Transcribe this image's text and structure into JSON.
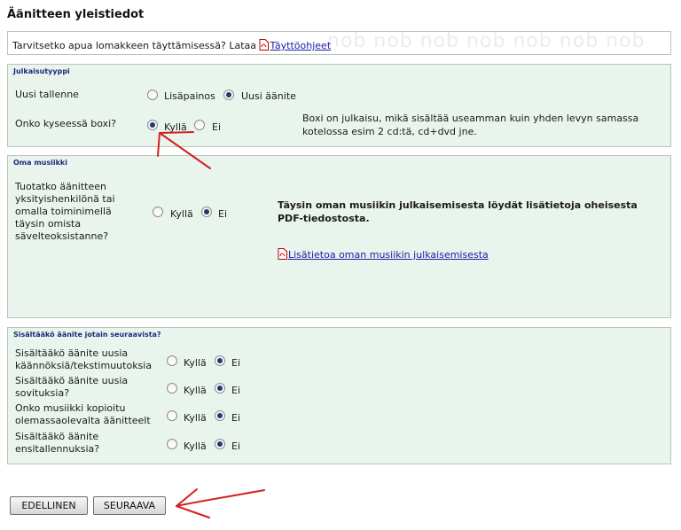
{
  "page": {
    "title": "Äänitteen yleistiedot"
  },
  "help": {
    "text": "Tarvitsetko apua lomakkeen täyttämisessä? Lataa",
    "link": "Täyttöohjeet",
    "watermark": "nob nob nob nob nob nob nob"
  },
  "julkaisutyyppi": {
    "legend": "Julkaisutyyppi",
    "uusi_tallenne": {
      "label": "Uusi tallenne",
      "option_lisapainos": "Lisäpainos",
      "option_uusi_aanite": "Uusi äänite",
      "selected": "Uusi äänite"
    },
    "boxi": {
      "label": "Onko kyseessä boxi?",
      "option_yes": "Kyllä",
      "option_no": "Ei",
      "selected": "Kyllä",
      "info_line1": "Boxi on julkaisu, mikä sisältää useamman kuin yhden levyn samassa",
      "info_line2": "kotelossa esim 2 cd:tä, cd+dvd jne."
    }
  },
  "oma_musiikki": {
    "legend": "Oma musiikki",
    "question_line1": "Tuotatko äänitteen",
    "question_line2": "yksityishenkilönä tai",
    "question_line3": "omalla toiminimellä",
    "question_line4": "täysin omista",
    "question_line5": "sävelteoksistanne?",
    "option_yes": "Kyllä",
    "option_no": "Ei",
    "selected": "Ei",
    "info_line1": "Täysin oman musiikin julkaisemisesta löydät lisätietoja oheisesta",
    "info_line2": "PDF-tiedostosta.",
    "link": "Lisätietoa oman musiikin julkaisemisesta"
  },
  "sisaltaa": {
    "legend": "Sisältääkö äänite jotain seuraavista?",
    "rows": [
      {
        "line1": "Sisältääkö äänite uusia",
        "line2": "käännöksiä/tekstimuutoksia",
        "option_yes": "Kyllä",
        "option_no": "Ei",
        "selected": "Ei"
      },
      {
        "line1": "Sisältääkö äänite uusia",
        "line2": "sovituksia?",
        "option_yes": "Kyllä",
        "option_no": "Ei",
        "selected": "Ei"
      },
      {
        "line1": "Onko musiikki kopioitu",
        "line2": "olemassaolevalta äänitteelt",
        "option_yes": "Kyllä",
        "option_no": "Ei",
        "selected": "Ei"
      },
      {
        "line1": "Sisältääkö äänite",
        "line2": "ensitallennuksia?",
        "option_yes": "Kyllä",
        "option_no": "Ei",
        "selected": "Ei"
      }
    ]
  },
  "buttons": {
    "previous": "EDELLINEN",
    "next": "SEURAAVA"
  },
  "colors": {
    "panel_bg": "#e9f5ec",
    "legend": "#1a2a7a",
    "link": "#1a1aa6",
    "annotation": "#d42020"
  }
}
